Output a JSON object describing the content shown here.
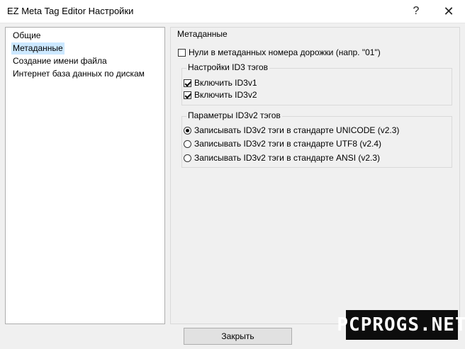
{
  "window": {
    "title": "EZ Meta Tag Editor Настройки",
    "help_glyph": "?",
    "close_glyph": "✕"
  },
  "nav": {
    "items": [
      {
        "label": "Общие",
        "selected": false
      },
      {
        "label": "Метаданные",
        "selected": true
      },
      {
        "label": "Создание имени файла",
        "selected": false
      },
      {
        "label": "Интернет база данных по дискам",
        "selected": false
      }
    ]
  },
  "panel": {
    "title": "Метаданные",
    "zeros_checkbox": {
      "label": "Нули в метаданных номера дорожки (напр. \"01\")",
      "checked": false
    },
    "id3_group": {
      "title": "Настройки ID3 тэгов",
      "enable_id3v1": {
        "label": "Включить ID3v1",
        "checked": true
      },
      "enable_id3v2": {
        "label": "Включить ID3v2",
        "checked": true
      }
    },
    "id3v2_group": {
      "title": "Параметры ID3v2 тэгов",
      "options": [
        {
          "label": "Записывать ID3v2 тэги в стандарте UNICODE (v2.3)",
          "selected": true
        },
        {
          "label": "Записывать ID3v2 тэги в стандарте UTF8 (v2.4)",
          "selected": false
        },
        {
          "label": "Записывать ID3v2 тэги в стандарте ANSI (v2.3)",
          "selected": false
        }
      ]
    }
  },
  "footer": {
    "close_label": "Закрыть"
  },
  "watermark": "PCPROGS.NET"
}
